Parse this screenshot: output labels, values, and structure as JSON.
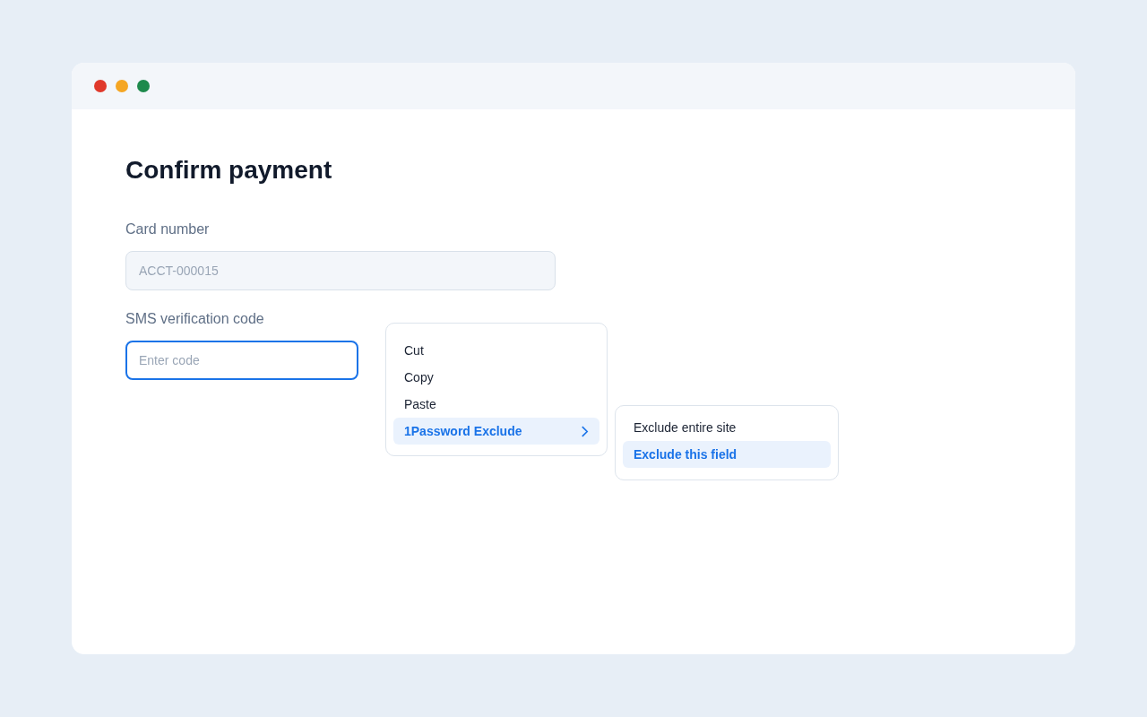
{
  "window": {
    "controls": [
      {
        "color": "#e0392b"
      },
      {
        "color": "#f5a623"
      },
      {
        "color": "#1e8a4c"
      }
    ]
  },
  "heading": "Confirm payment",
  "fields": [
    {
      "label": "Card number",
      "value": "ACCT-000015",
      "disabled": true,
      "focused": false
    },
    {
      "label": "SMS verification code",
      "placeholder": "Enter code",
      "disabled": false,
      "focused": true
    }
  ],
  "context_menu": {
    "items": [
      {
        "label": "Cut",
        "selected": false,
        "has_submenu": false
      },
      {
        "label": "Copy",
        "selected": false,
        "has_submenu": false
      },
      {
        "label": "Paste",
        "selected": false,
        "has_submenu": false
      },
      {
        "label": "1Password Exclude",
        "selected": true,
        "has_submenu": true
      }
    ]
  },
  "submenu": {
    "items": [
      {
        "label": "Exclude entire site",
        "selected": false
      },
      {
        "label": "Exclude this field",
        "selected": true
      }
    ]
  }
}
